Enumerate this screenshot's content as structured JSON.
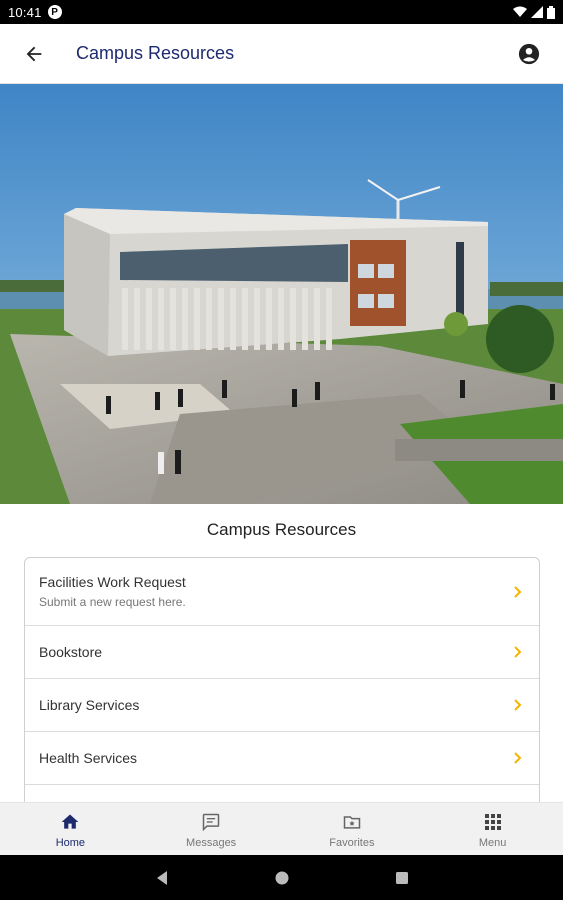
{
  "status_bar": {
    "time": "10:41",
    "notif_letter": "P"
  },
  "app_bar": {
    "title": "Campus Resources"
  },
  "section": {
    "title": "Campus Resources"
  },
  "resources": [
    {
      "title": "Facilities Work Request",
      "subtitle": "Submit a new request here."
    },
    {
      "title": "Bookstore"
    },
    {
      "title": "Library Services"
    },
    {
      "title": "Health Services"
    }
  ],
  "bottom_nav": [
    {
      "label": "Home",
      "icon": "home-icon",
      "active": true
    },
    {
      "label": "Messages",
      "icon": "messages-icon",
      "active": false
    },
    {
      "label": "Favorites",
      "icon": "favorites-icon",
      "active": false
    },
    {
      "label": "Menu",
      "icon": "grid-menu-icon",
      "active": false
    }
  ],
  "colors": {
    "primary": "#1d2a6e",
    "chevron": "#f4b400",
    "nav_bg": "#f1f1f1"
  }
}
